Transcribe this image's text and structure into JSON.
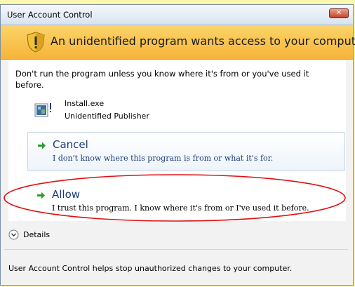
{
  "window": {
    "title": "User Account Control",
    "close_label": "✕"
  },
  "banner": {
    "text": "An unidentified program wants access to your computer",
    "icon": "shield-warning-icon"
  },
  "content": {
    "warning": "Don't run the program unless you know where it's from or you've used it before.",
    "program_name": "Install.exe",
    "publisher": "Unidentified Publisher"
  },
  "options": {
    "cancel": {
      "title": "Cancel",
      "description": "I don't know where this program is from or what it's for."
    },
    "allow": {
      "title": "Allow",
      "description": "I trust this program. I know where it's from or I've used it before."
    }
  },
  "details": {
    "label": "Details"
  },
  "footer": {
    "text": "User Account Control helps stop unauthorized changes to your computer."
  },
  "colors": {
    "banner": "#f6b43a",
    "link_text": "#1c3a7a",
    "arrow": "#2a9d2a",
    "highlight_ellipse": "#e01010"
  }
}
